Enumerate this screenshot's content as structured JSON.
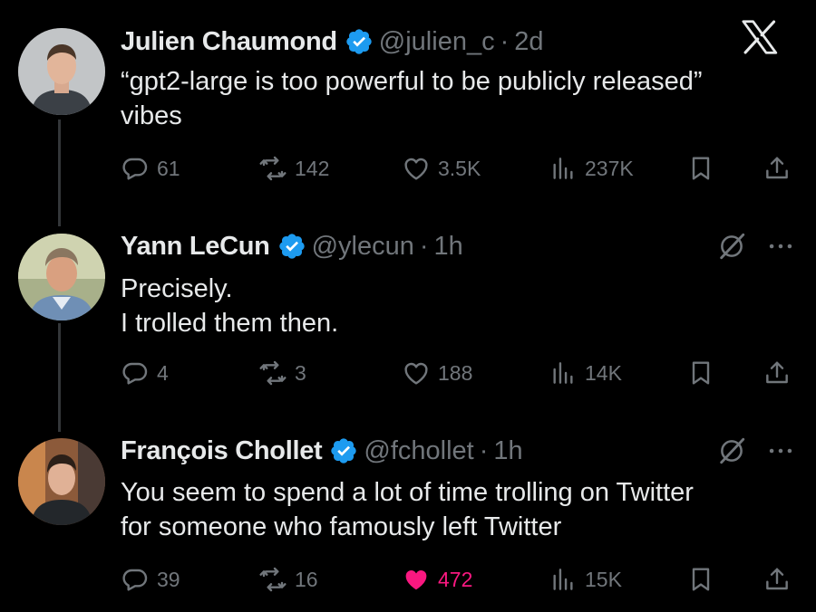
{
  "tweets": [
    {
      "name": "Julien Chaumond",
      "handle": "@julien_c",
      "separator": "·",
      "time": "2d",
      "lines": [
        "“gpt2-large is too powerful to be publicly released”",
        "vibes"
      ],
      "replies": "61",
      "retweets": "142",
      "likes": "3.5K",
      "views": "237K",
      "liked": false
    },
    {
      "name": "Yann LeCun",
      "handle": "@ylecun",
      "separator": "·",
      "time": "1h",
      "lines": [
        "Precisely.",
        "I trolled them then."
      ],
      "replies": "4",
      "retweets": "3",
      "likes": "188",
      "views": "14K",
      "liked": false
    },
    {
      "name": "François Chollet",
      "handle": "@fchollet",
      "separator": "·",
      "time": "1h",
      "lines": [
        "You seem to spend a lot of time trolling on Twitter",
        "for someone who famously left Twitter"
      ],
      "replies": "39",
      "retweets": "16",
      "likes": "472",
      "views": "15K",
      "liked": true
    }
  ],
  "icons": {
    "app_logo": "x-logo-icon",
    "verified": "verified-badge-icon",
    "reply": "reply-icon",
    "retweet": "retweet-icon",
    "like": "heart-icon",
    "views": "views-icon",
    "bookmark": "bookmark-icon",
    "share": "share-icon",
    "grok": "grok-icon",
    "more": "more-icon"
  },
  "colors": {
    "background": "#000000",
    "text": "#e7e9ea",
    "secondary": "#71767b",
    "verified": "#1d9bf0",
    "liked": "#f91880"
  }
}
